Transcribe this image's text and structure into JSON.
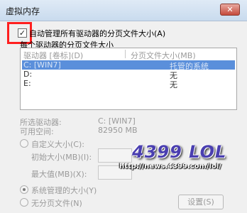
{
  "window": {
    "title": "虚拟内存",
    "close_glyph": "✕"
  },
  "auto_manage": {
    "checked": true,
    "check_glyph": "✓",
    "label": "自动管理所有驱动器的分页文件大小(A)"
  },
  "each_drive_label": "每个驱动器的分页文件大小",
  "drive_list": {
    "headers": {
      "drive": "驱动器 [卷标](D)",
      "size": "分页文件大小(MB)"
    },
    "rows": [
      {
        "drive": "C:   [WIN7]",
        "size": "托管的系统",
        "selected": true
      },
      {
        "drive": "D:",
        "size": "无",
        "selected": false
      },
      {
        "drive": "E:",
        "size": "无",
        "selected": false
      }
    ]
  },
  "info": {
    "selected_drive_label": "所选驱动器:",
    "selected_drive_value": "C:   [WIN7]",
    "free_space_label": "可用空间:",
    "free_space_value": "82950 MB"
  },
  "custom_size": {
    "label": "自定义大小(C):",
    "initial_label": "初始大小(MB)(I):",
    "initial_value": "",
    "max_label": "最大值(MB)(X):",
    "max_value": ""
  },
  "system_managed": {
    "label": "系统管理的大小(Y)",
    "selected": true
  },
  "no_paging": {
    "label": "无分页文件(N)",
    "selected": false
  },
  "set_button": "设置(S)",
  "watermark": {
    "logo": "4399 LOL",
    "url": "http://news.4399.com/lol/"
  },
  "colors": {
    "selection": "#5a8fdb",
    "highlight_box": "#ff1f1f",
    "close_button": "#c54a3c"
  }
}
